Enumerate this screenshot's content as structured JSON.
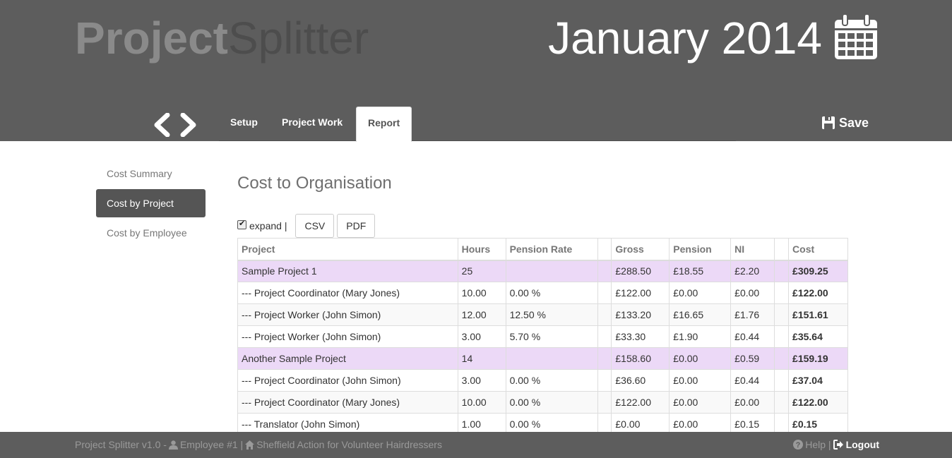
{
  "header": {
    "brand_bold": "Project",
    "brand_light": "Splitter",
    "month": "January 2014"
  },
  "tabs": [
    {
      "label": "Setup"
    },
    {
      "label": "Project Work"
    },
    {
      "label": "Report"
    }
  ],
  "save_label": "Save",
  "sidenav": [
    {
      "label": "Cost Summary"
    },
    {
      "label": "Cost by Project"
    },
    {
      "label": "Cost by Employee"
    }
  ],
  "main": {
    "title": "Cost to Organisation",
    "expand_label": "expand |",
    "csv_label": "CSV",
    "pdf_label": "PDF"
  },
  "table": {
    "headers": [
      "Project",
      "Hours",
      "Pension Rate",
      "",
      "Gross",
      "Pension",
      "NI",
      "",
      "Cost"
    ],
    "rows": [
      [
        "Sample Project 1",
        "25",
        "",
        "",
        "£288.50",
        "£18.55",
        "£2.20",
        "",
        "£309.25"
      ],
      [
        "--- Project Coordinator (Mary Jones)",
        "10.00",
        "0.00 %",
        "",
        "£122.00",
        "£0.00",
        "£0.00",
        "",
        "£122.00"
      ],
      [
        "--- Project Worker (John Simon)",
        "12.00",
        "12.50 %",
        "",
        "£133.20",
        "£16.65",
        "£1.76",
        "",
        "£151.61"
      ],
      [
        "--- Project Worker (John Simon)",
        "3.00",
        "5.70 %",
        "",
        "£33.30",
        "£1.90",
        "£0.44",
        "",
        "£35.64"
      ],
      [
        "Another Sample Project",
        "14",
        "",
        "",
        "£158.60",
        "£0.00",
        "£0.59",
        "",
        "£159.19"
      ],
      [
        "--- Project Coordinator (John Simon)",
        "3.00",
        "0.00 %",
        "",
        "£36.60",
        "£0.00",
        "£0.44",
        "",
        "£37.04"
      ],
      [
        "--- Project Coordinator (Mary Jones)",
        "10.00",
        "0.00 %",
        "",
        "£122.00",
        "£0.00",
        "£0.00",
        "",
        "£122.00"
      ],
      [
        "--- Translator (John Simon)",
        "1.00",
        "0.00 %",
        "",
        "£0.00",
        "£0.00",
        "£0.15",
        "",
        "£0.15"
      ]
    ]
  },
  "footer": {
    "version": "Project Splitter v1.0 -",
    "employee": "Employee #1 |",
    "organisation": "Sheffield Action for Volunteer Hairdressers",
    "help": "Help |",
    "logout": "Logout"
  },
  "colors": {
    "header_bg": "#5d5d5d",
    "project_row_bg": "#ecd9f7",
    "active_nav_bg": "#555555"
  },
  "icons": [
    "calendar-icon",
    "chevron-left-icon",
    "chevron-right-icon",
    "floppy-disk-icon",
    "user-icon",
    "home-icon",
    "question-circle-icon",
    "logout-icon"
  ]
}
